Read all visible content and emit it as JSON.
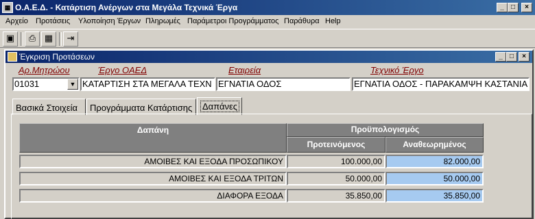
{
  "window": {
    "title": "Ο.Α.Ε.Δ. - Κατάρτιση Ανέργων στα Μεγάλα Τεχνικά Έργα",
    "minimize": "_",
    "maximize": "□",
    "close": "×"
  },
  "menu": {
    "items": [
      "Αρχείο",
      "Προτάσεις",
      "Υλοποίηση Έργων",
      "Πληρωμές",
      "Παράμετροι Προγράμματος",
      "Παράθυρα",
      "Help"
    ]
  },
  "toolbar": {
    "icons": [
      "save-icon",
      "print-icon",
      "layout-icon",
      "exit-door-icon"
    ]
  },
  "child": {
    "title": "Έγκριση Προτάσεων"
  },
  "form": {
    "labels": {
      "protocol": "Αρ.Μητρώου",
      "project_oaed": "Έργο ΟΑΕΔ",
      "company": "Εταιρεία",
      "tech_project": "Τεχνικό Έργο"
    },
    "values": {
      "protocol": "01031",
      "project_oaed": "ΚΑΤΑΡΤΙΣΗ ΣΤΑ ΜΕΓΑΛΑ ΤΕΧΝ",
      "company": "ΕΓΝΑΤΙΑ ΟΔΟΣ",
      "tech_project": "ΕΓΝΑΤΙΑ ΟΔΟΣ - ΠΑΡΑΚΑΜΨΗ ΚΑΣΤΑΝΙΑ"
    }
  },
  "tabs": {
    "basic": "Βασικά Στοιχεία",
    "programs": "Προγράμματα Κατάρτισης",
    "expenses": "Δαπάνες"
  },
  "grid": {
    "header_expense": "Δαπάνη",
    "header_budget": "Προϋπολογισμός",
    "header_proposed": "Προτεινόμενος",
    "header_revised": "Αναθεωρημένος",
    "rows": [
      {
        "name": "ΑΜΟΙΒΕΣ ΚΑΙ ΕΞΟΔΑ ΠΡΟΣΩΠΙΚΟΥ",
        "proposed": "100.000,00",
        "revised": "82.000,00"
      },
      {
        "name": "ΑΜΟΙΒΕΣ ΚΑΙ ΕΞΟΔΑ ΤΡΙΤΩΝ",
        "proposed": "50.000,00",
        "revised": "50.000,00"
      },
      {
        "name": "ΔΙΑΦΟΡΑ ΕΞΟΔΑ",
        "proposed": "35.850,00",
        "revised": "35.850,00"
      }
    ]
  }
}
